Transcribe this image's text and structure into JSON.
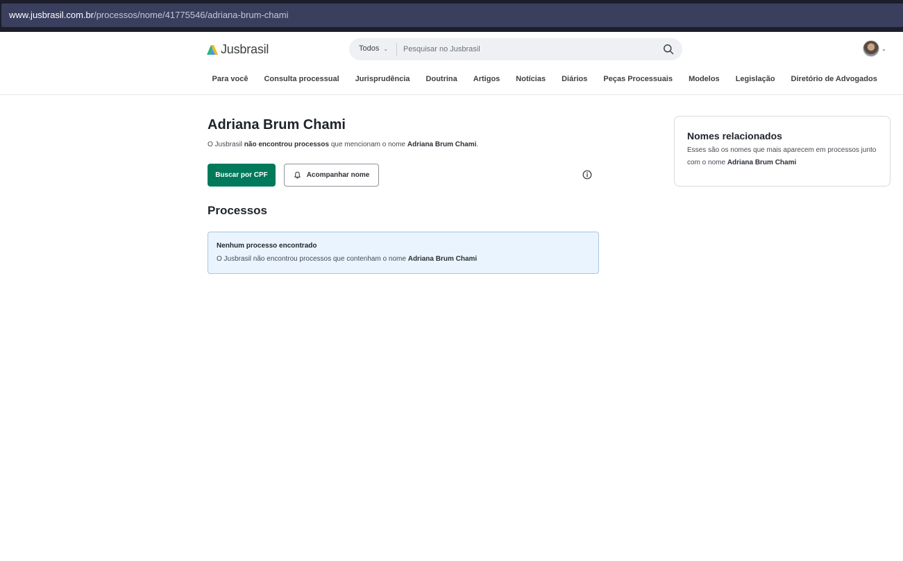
{
  "browser": {
    "url_host": "www.jusbrasil.com.br",
    "url_path": "/processos/nome/41775546/adriana-brum-chami"
  },
  "header": {
    "logo_text": "Jusbrasil",
    "search": {
      "scope": "Todos",
      "placeholder": "Pesquisar no Jusbrasil"
    },
    "nav": [
      "Para você",
      "Consulta processual",
      "Jurisprudência",
      "Doutrina",
      "Artigos",
      "Notícias",
      "Diários",
      "Peças Processuais",
      "Modelos",
      "Legislação",
      "Diretório de Advogados"
    ]
  },
  "main": {
    "title": "Adriana Brum Chami",
    "subtitle": {
      "prefix": "O Jusbrasil ",
      "bold1": "não encontrou processos",
      "middle": " que mencionam o nome ",
      "name": "Adriana Brum Chami",
      "suffix": "."
    },
    "buttons": {
      "cpf": "Buscar por CPF",
      "follow": "Acompanhar nome"
    },
    "section_title": "Processos",
    "alert": {
      "title": "Nenhum processo encontrado",
      "text": "O Jusbrasil não encontrou processos que contenham o nome ",
      "name": "Adriana Brum Chami"
    }
  },
  "sidebar": {
    "title": "Nomes relacionados",
    "text": "Esses são os nomes que mais aparecem em processos junto com o nome ",
    "name": "Adriana Brum Chami"
  },
  "colors": {
    "primary_green": "#007a5a",
    "alert_bg": "#eaf4fe",
    "alert_border": "#a8c6e0"
  }
}
